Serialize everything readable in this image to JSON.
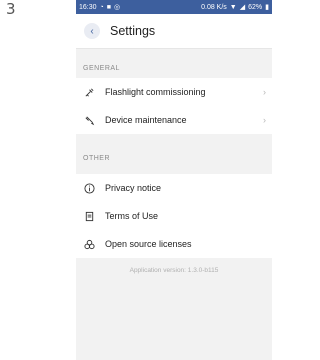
{
  "step_number": "3",
  "status_bar": {
    "time": "16:30",
    "left_icons": [
      "notification-icon",
      "message-icon",
      "signal-icon"
    ],
    "speed": "0.08 K/s",
    "battery": "62%"
  },
  "header": {
    "title": "Settings"
  },
  "sections": [
    {
      "title": "GENERAL",
      "items": [
        {
          "label": "Flashlight commissioning",
          "icon": "flashlight-icon",
          "chevron": true
        },
        {
          "label": "Device maintenance",
          "icon": "wrench-icon",
          "chevron": true
        }
      ]
    },
    {
      "title": "OTHER",
      "items": [
        {
          "label": "Privacy notice",
          "icon": "info-icon",
          "chevron": false
        },
        {
          "label": "Terms of Use",
          "icon": "document-icon",
          "chevron": false
        },
        {
          "label": "Open source licenses",
          "icon": "licenses-icon",
          "chevron": false
        }
      ]
    }
  ],
  "footer": {
    "version": "Application version: 1.3.0-b115"
  },
  "colors": {
    "status_bar": "#3d5f9e",
    "background": "#f2f2f2",
    "accent": "#3d5f9e"
  }
}
